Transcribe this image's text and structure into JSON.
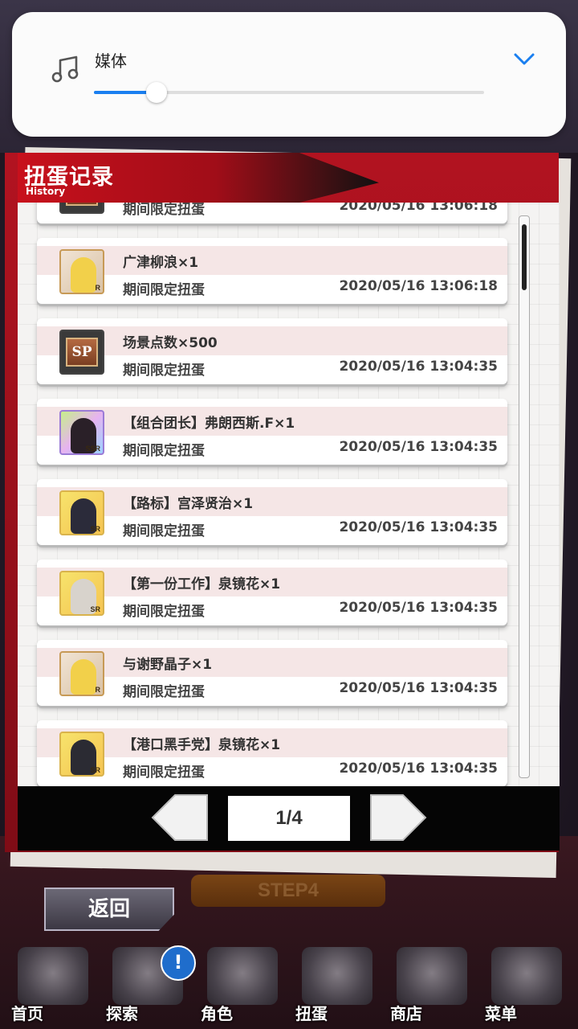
{
  "volume_panel": {
    "label": "媒体",
    "level": 0.08,
    "accent_color": "#1a7ff0",
    "icon": "music-note-icon",
    "expand_icon": "chevron-down-icon"
  },
  "history": {
    "title": "扭蛋记录",
    "subtitle": "History",
    "rows": [
      {
        "item": "",
        "source": "期间限定扭蛋",
        "time": "2020/05/16 13:06:18",
        "portrait": "sp"
      },
      {
        "item": "广津柳浪×1",
        "source": "期间限定扭蛋",
        "time": "2020/05/16 13:06:18",
        "portrait": "r",
        "rarity": "R"
      },
      {
        "item": "场景点数×500",
        "source": "期间限定扭蛋",
        "time": "2020/05/16 13:04:35",
        "portrait": "sp"
      },
      {
        "item": "【组合团长】弗朗西斯.F×1",
        "source": "期间限定扭蛋",
        "time": "2020/05/16 13:04:35",
        "portrait": "ssr",
        "rarity": "SSR"
      },
      {
        "item": "【路标】宫泽贤治×1",
        "source": "期间限定扭蛋",
        "time": "2020/05/16 13:04:35",
        "portrait": "sr",
        "rarity": "SR"
      },
      {
        "item": "【第一份工作】泉镜花×1",
        "source": "期间限定扭蛋",
        "time": "2020/05/16 13:04:35",
        "portrait": "sr",
        "rarity": "SR"
      },
      {
        "item": "与谢野晶子×1",
        "source": "期间限定扭蛋",
        "time": "2020/05/16 13:04:35",
        "portrait": "r",
        "rarity": "R"
      },
      {
        "item": "【港口黑手党】泉镜花×1",
        "source": "期间限定扭蛋",
        "time": "2020/05/16 13:04:35",
        "portrait": "sr",
        "rarity": "SR"
      }
    ],
    "sp_text": "SP",
    "page": "1/4"
  },
  "step_label": "STEP4",
  "back_label": "返回",
  "notify_badge": "!",
  "nav": [
    {
      "label": "首页",
      "icon": "home-icon"
    },
    {
      "label": "探索",
      "icon": "explore-icon"
    },
    {
      "label": "角色",
      "icon": "characters-icon"
    },
    {
      "label": "扭蛋",
      "icon": "gacha-icon"
    },
    {
      "label": "商店",
      "icon": "shop-icon"
    },
    {
      "label": "菜单",
      "icon": "gear-icon"
    }
  ]
}
